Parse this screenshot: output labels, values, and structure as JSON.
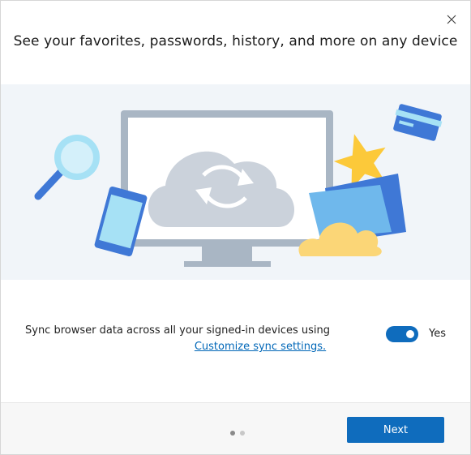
{
  "dialog": {
    "title": "See your favorites, passwords, history, and more on any device",
    "close_icon": "close-icon"
  },
  "illustration": {
    "icons": [
      "magnifier-icon",
      "phone-icon",
      "monitor-icon",
      "cloud-sync-icon",
      "credit-card-icon",
      "star-icon",
      "folder-icon",
      "cloud-icon"
    ],
    "colors": {
      "background": "#f1f5f9",
      "accent_blue": "#3f78d6",
      "light_blue": "#a6e1f5",
      "star": "#fcc93a"
    }
  },
  "sync": {
    "description": "Sync browser data across all your signed-in devices using",
    "link_label": "Customize sync settings.",
    "toggle_state": "Yes",
    "toggle_on": true
  },
  "footer": {
    "page_indicator": {
      "current": 1,
      "total": 2
    },
    "next_label": "Next"
  },
  "theme": {
    "primary": "#0f6cbd",
    "link": "#0067b8"
  }
}
